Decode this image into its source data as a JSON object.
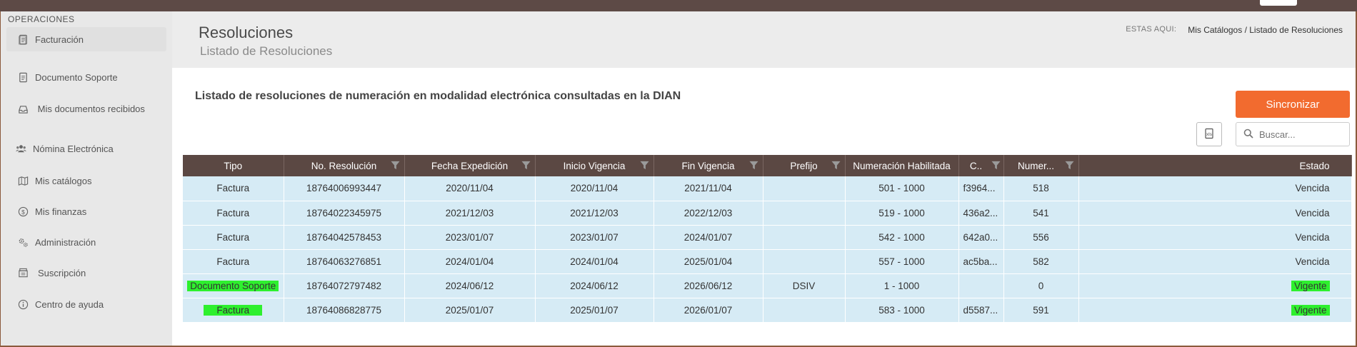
{
  "sidebar": {
    "heading": "OPERACIONES",
    "items": [
      {
        "label": "Facturación",
        "icon": "document-icon"
      },
      {
        "label": "Documento Soporte",
        "icon": "document-icon"
      },
      {
        "label": "Mis documentos recibidos",
        "icon": "inbox-icon"
      },
      {
        "label": "Nómina Electrónica",
        "icon": "users-icon"
      },
      {
        "label": "Mis catálogos",
        "icon": "map-icon"
      },
      {
        "label": "Mis finanzas",
        "icon": "dollar-icon"
      },
      {
        "label": "Administración",
        "icon": "gears-icon"
      },
      {
        "label": "Suscripción",
        "icon": "subscription-icon"
      },
      {
        "label": "Centro de ayuda",
        "icon": "info-icon"
      }
    ]
  },
  "header": {
    "title": "Resoluciones",
    "subtitle": "Listado de Resoluciones",
    "breadcrumb_label": "ESTAS AQUI:",
    "breadcrumb_path": "Mis Catálogos / Listado de Resoluciones"
  },
  "panel": {
    "title": "Listado de resoluciones de numeración en modalidad electrónica consultadas en la DIAN",
    "sync_button": "Sincronizar",
    "search_placeholder": "Buscar..."
  },
  "table": {
    "columns": [
      "Tipo",
      "No. Resolución",
      "Fecha Expedición",
      "Inicio Vigencia",
      "Fin Vigencia",
      "Prefijo",
      "Numeración Habilitada",
      "C..",
      "Numer...",
      "Estado"
    ],
    "rows": [
      [
        "Factura",
        "18764006993447",
        "2020/11/04",
        "2020/11/04",
        "2021/11/04",
        "",
        "501 - 1000",
        "f3964...",
        "518",
        "Vencida"
      ],
      [
        "Factura",
        "18764022345975",
        "2021/12/03",
        "2021/12/03",
        "2022/12/03",
        "",
        "519 - 1000",
        "436a2...",
        "541",
        "Vencida"
      ],
      [
        "Factura",
        "18764042578453",
        "2023/01/07",
        "2023/01/07",
        "2024/01/07",
        "",
        "542 - 1000",
        "642a0...",
        "556",
        "Vencida"
      ],
      [
        "Factura",
        "18764063276851",
        "2024/01/04",
        "2024/01/04",
        "2025/01/04",
        "",
        "557 - 1000",
        "ac5ba...",
        "582",
        "Vencida"
      ],
      [
        "Documento Soporte",
        "18764072797482",
        "2024/06/12",
        "2024/06/12",
        "2026/06/12",
        "DSIV",
        "1 - 1000",
        "",
        "0",
        "Vigente"
      ],
      [
        "Factura",
        "18764086828775",
        "2025/01/07",
        "2025/01/07",
        "2026/01/07",
        "",
        "583 - 1000",
        "d5587...",
        "591",
        "Vigente"
      ]
    ],
    "highlighted_rows": [
      4,
      5
    ],
    "highlight_color": "#2ef02e"
  },
  "colors": {
    "accent": "#f26b2f",
    "table_header": "#5b4843",
    "row_bg": "#d6ebf5",
    "topbar": "#5d4a46"
  }
}
